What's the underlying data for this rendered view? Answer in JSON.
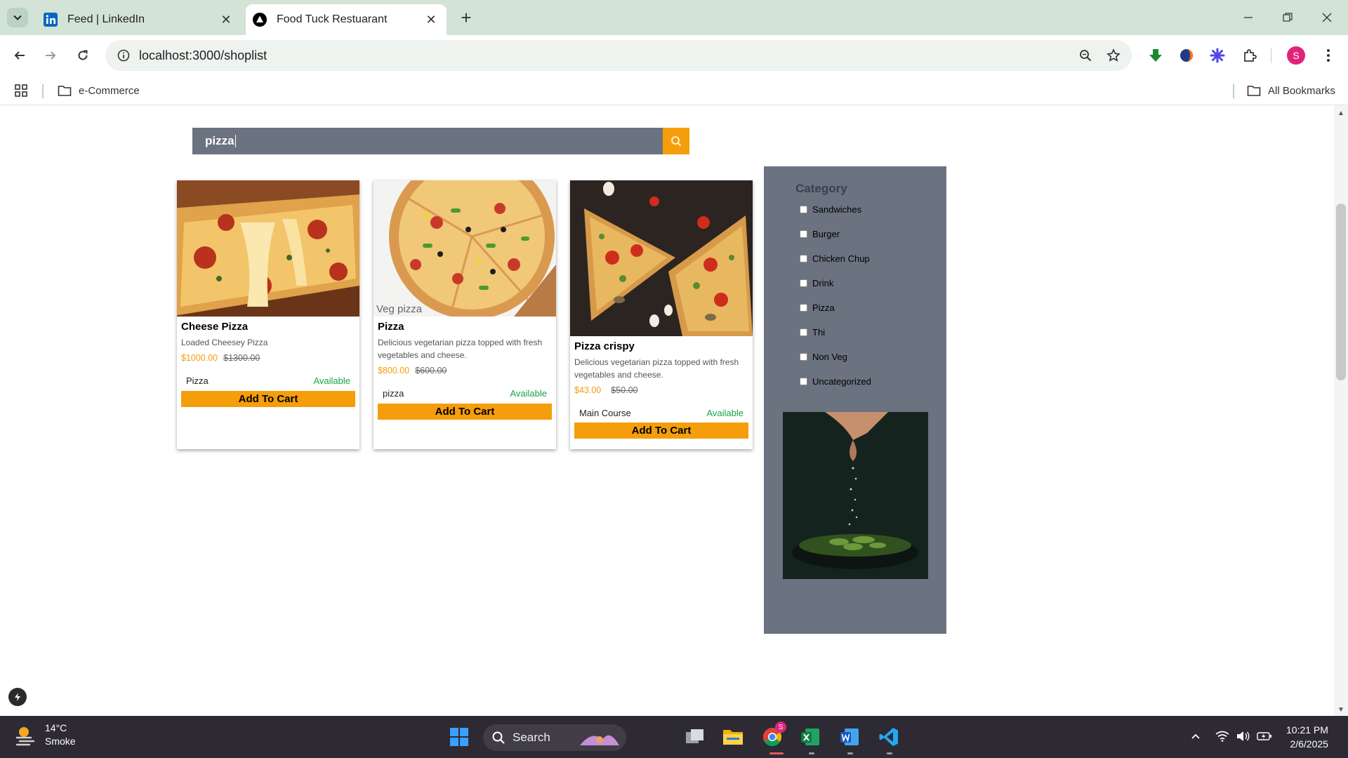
{
  "browser": {
    "tabs": [
      {
        "title": "Feed | LinkedIn",
        "icon": "linkedin-icon"
      },
      {
        "title": "Food Tuck Restuarant",
        "icon": "vercel-icon"
      }
    ],
    "url": "localhost:3000/shoplist",
    "bookmarks": [
      {
        "label": "e-Commerce"
      },
      {
        "label": "All Bookmarks"
      }
    ],
    "profile_initial": "S"
  },
  "search": {
    "value": "pizza"
  },
  "products": [
    {
      "name": "Cheese Pizza",
      "description": "Loaded Cheesey Pizza",
      "price": "$1000.00",
      "old_price": "$1300.00",
      "category": "Pizza",
      "status": "Available",
      "cart_label": "Add To Cart"
    },
    {
      "image_caption": "Veg pizza",
      "name": "Pizza",
      "description": "Delicious vegetarian pizza topped with fresh vegetables and cheese.",
      "price": "$800.00",
      "old_price": "$600.00",
      "category": "pizza",
      "status": "Available",
      "cart_label": "Add To Cart"
    },
    {
      "name": "Pizza crispy",
      "description": "Delicious vegetarian pizza topped with fresh vegetables and cheese.",
      "price": "$43.00",
      "old_price": "$50.00",
      "category": "Main Course",
      "status": "Available",
      "cart_label": "Add To Cart"
    }
  ],
  "sidebar": {
    "heading": "Category",
    "categories": [
      "Sandwiches",
      "Burger",
      "Chicken Chup",
      "Drink",
      "Pizza",
      "Thi",
      "Non Veg",
      "Uncategorized"
    ]
  },
  "taskbar": {
    "weather_temp": "14°C",
    "weather_desc": "Smoke",
    "search_label": "Search",
    "time": "10:21 PM",
    "date": "2/6/2025",
    "chrome_badge": "S"
  },
  "colors": {
    "accent": "#f59e0b",
    "available": "#16a34a",
    "panel": "#6b7280"
  }
}
